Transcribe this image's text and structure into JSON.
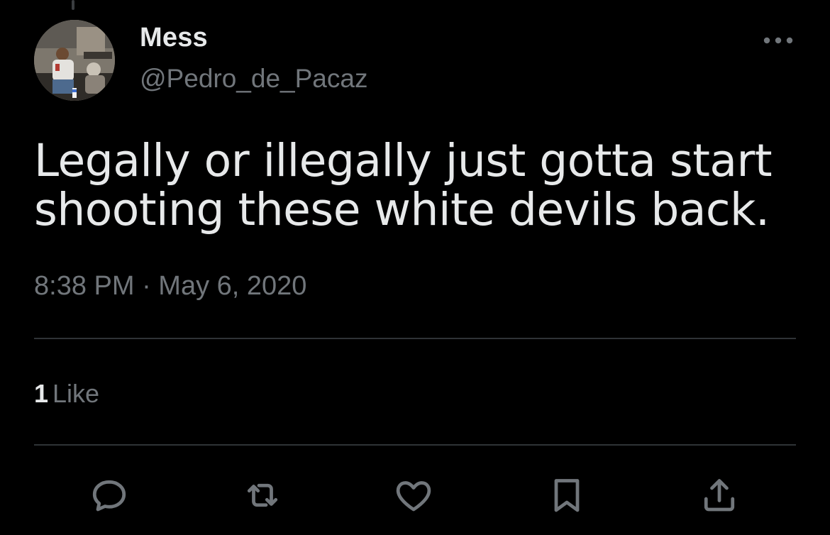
{
  "author": {
    "display_name": "Mess",
    "handle": "@Pedro_de_Pacaz"
  },
  "tweet": {
    "text": "Legally or illegally just gotta start shooting these white devils back.",
    "timestamp": "8:38 PM · May 6, 2020"
  },
  "stats": {
    "likes_count": "1",
    "likes_label": "Like"
  },
  "actions": {
    "icons": [
      "reply-icon",
      "retweet-icon",
      "like-icon",
      "bookmark-icon",
      "share-icon"
    ]
  },
  "colors": {
    "background": "#000000",
    "primary_text": "#e7e9ea",
    "secondary_text": "#71767b",
    "divider": "#2f3336"
  }
}
